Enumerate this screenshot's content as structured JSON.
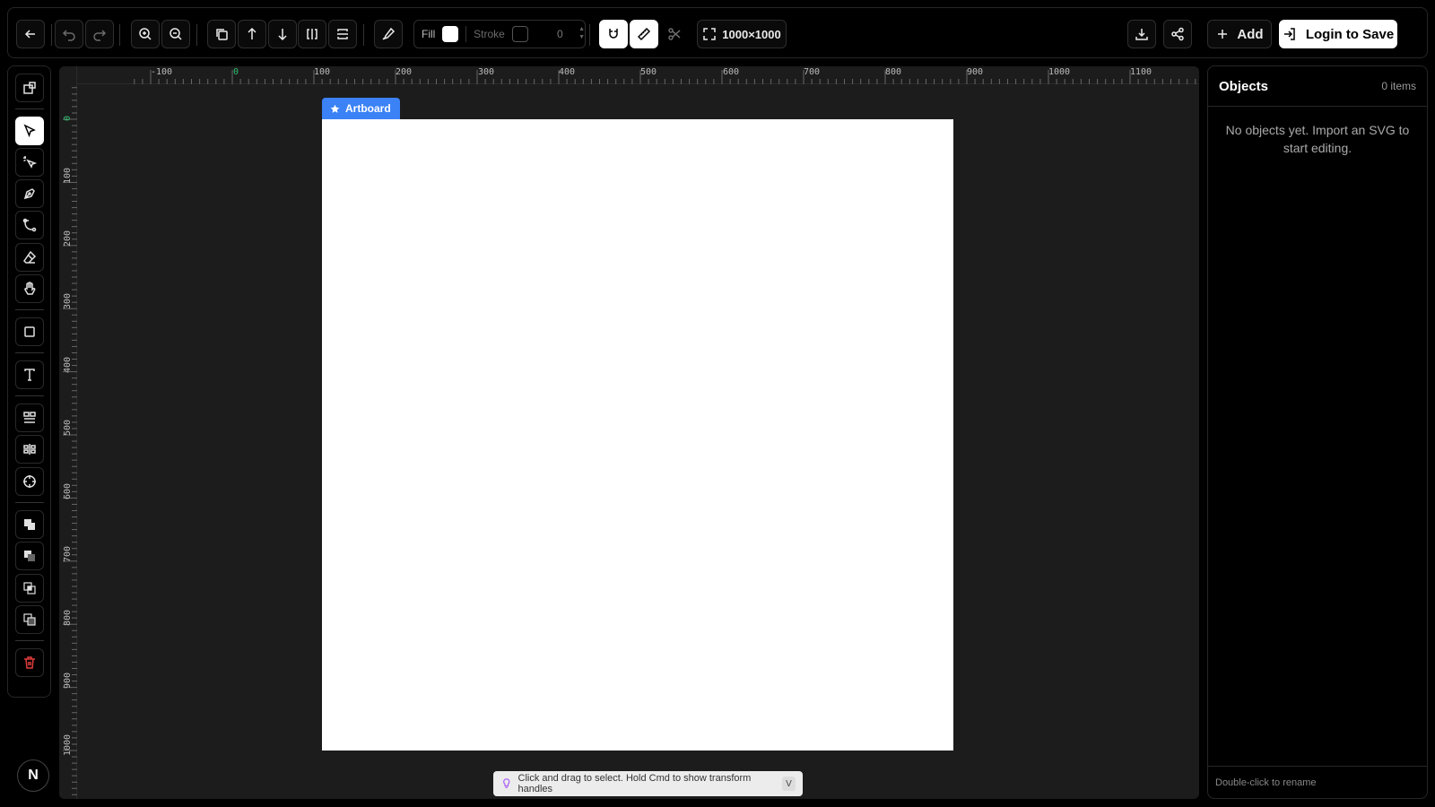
{
  "toolbar": {
    "fill_label": "Fill",
    "stroke_label": "Stroke",
    "stroke_width_value": "0",
    "canvas_size_label": "1000×1000",
    "add_label": "Add",
    "login_label": "Login to Save"
  },
  "rulers": {
    "horizontal": [
      "-100",
      "0",
      "100",
      "200",
      "300",
      "400",
      "500",
      "600",
      "700",
      "800",
      "900",
      "1000",
      "1100"
    ],
    "vertical": [
      "0",
      "100",
      "200",
      "300",
      "400",
      "500",
      "600",
      "700",
      "800",
      "900",
      "1000"
    ]
  },
  "canvas": {
    "artboard_label": "Artboard",
    "hint_text": "Click and drag to select. Hold Cmd to show transform handles",
    "hint_key": "V"
  },
  "panel": {
    "title": "Objects",
    "count": "0 items",
    "empty_message": "No objects yet. Import an SVG to start editing.",
    "footer_hint": "Double-click to rename"
  },
  "user": {
    "avatar_letter": "N"
  },
  "colors": {
    "accent": "#3b82f6",
    "danger": "#e03c3c",
    "ruler_zero": "#2fbf71"
  }
}
